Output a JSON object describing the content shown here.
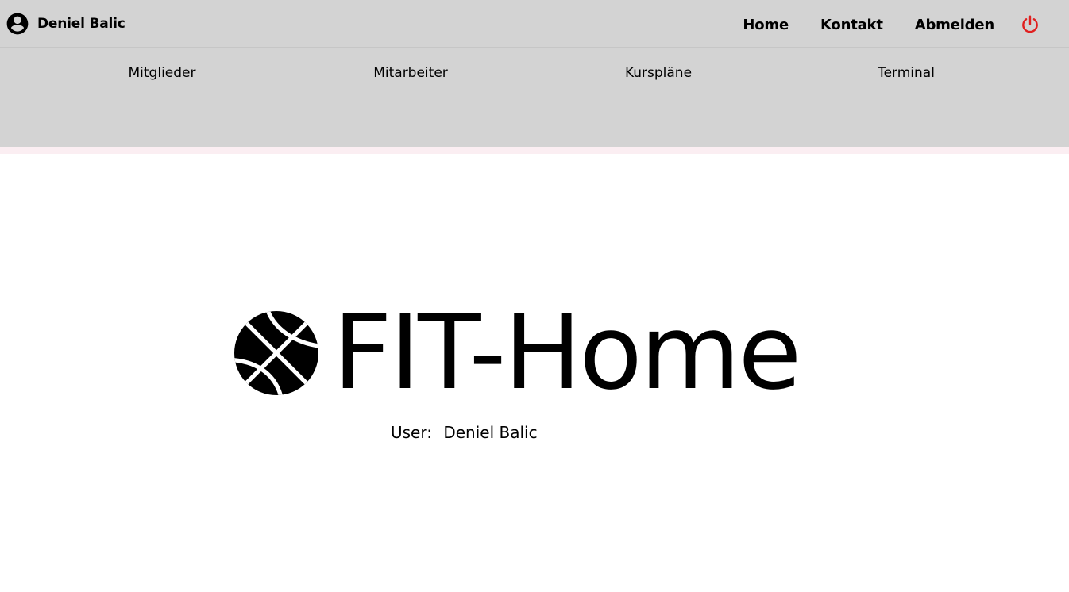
{
  "header": {
    "user_name": "Deniel Balic",
    "links": {
      "home": "Home",
      "contact": "Kontakt",
      "logout": "Abmelden"
    },
    "user_icon": "account-circle-icon",
    "power_icon": "power-icon",
    "power_color": "#e02020"
  },
  "subnav": {
    "items": [
      "Mitglieder",
      "Mitarbeiter",
      "Kurspläne",
      "Terminal"
    ]
  },
  "hero": {
    "logo_icon": "basketball-icon",
    "title": "FIT-Home"
  },
  "user_info": {
    "label": "User:",
    "value": "Deniel Balic"
  },
  "colors": {
    "header_bg": "#d3d3d3",
    "accent_line": "#fbeef2",
    "page_bg": "#ffffff"
  }
}
